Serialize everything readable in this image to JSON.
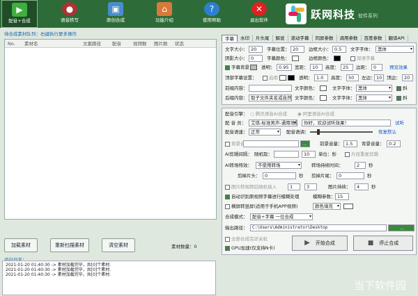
{
  "toolbar": {
    "items": [
      {
        "label": "配音+合成"
      },
      {
        "label": "语音转写"
      },
      {
        "label": "原创合成"
      },
      {
        "label": "功能介绍"
      },
      {
        "label": "使用帮助"
      },
      {
        "label": "退出软件"
      }
    ]
  },
  "brand": {
    "name": "跃网科技",
    "sub": "软件系列"
  },
  "queue": {
    "title": "待合成素材队列：右键执行更多操作",
    "headers": [
      "No.",
      "素材名",
      "文案路径",
      "配音",
      "视频数",
      "图片数",
      "状态"
    ],
    "load": "加载素材",
    "rescan": "重新扫描素材",
    "clear": "清空素材",
    "count_label": "素材数量：",
    "count": "0"
  },
  "log": {
    "title": "运行日志：",
    "lines": [
      "2021-01-20 01:40:30 -> 素材加载完毕，共[0]个素材.",
      "2021-01-20 01:40:30 -> 素材加载完毕，共[0]个素材.",
      "2021-01-20 01:40:30 -> 素材加载完毕，共[0]个素材."
    ]
  },
  "tabs": [
    "字幕",
    "水印",
    "片头尾",
    "解说",
    "滚动字幕",
    "同屏参数",
    "调用参数",
    "百度参数",
    "翻译API"
  ],
  "sub": {
    "font_size": "文字大小：",
    "font_size_v": "20",
    "pos": "字幕位置：",
    "pos_v": "20",
    "border": "边框大小：",
    "border_v": "0.5",
    "font": "文字字体：",
    "font_v": "黑体",
    "shadow": "阴影大小：",
    "shadow_v": "0",
    "color": "字幕颜色：",
    "bcolor": "边框颜色：",
    "dual": "双语字幕",
    "bg": "字幕背景",
    "alpha": "透明：",
    "alpha_v": "0.95",
    "wid": "宽距：",
    "wid_v": "10",
    "hgt": "高度：",
    "hgt_v": "25",
    "edge": "边距：",
    "edge_v": "0",
    "preview": "预览效果",
    "top": "顶部字幕设置：",
    "en": "启用",
    "alpha2": "透明：",
    "alpha2_v": "1.0",
    "height2": "高度：",
    "height2_v": "50",
    "left": "左边：",
    "left_v": "10",
    "topd": "顶边：",
    "topd_v": "20",
    "head": "前缀内容：",
    "tcolor": "文字颜色：",
    "tfont": "文字字体：",
    "tfont_v": "黑体",
    "italic": "斜",
    "tail": "后缀内容：",
    "tail_v": "取子文件夹名或自然",
    "tcolor2": "文字颜色：",
    "tfont2": "文字字体：",
    "tfont2_v": "黑体",
    "italic2": "斜"
  },
  "voice": {
    "engine": "配音引擎：",
    "opt1": "腾讯语音AI合成",
    "opt2": "阿里语音AI合成",
    "voice": "配 音 员：",
    "voice_v": "艾琪-标准男声-通用场景",
    "text_v": "你好，欢迎试听效果！",
    "listen": "试听",
    "speed": "配音语速：",
    "speed_v": "正常",
    "pitch": "配音语调：",
    "default": "恢复默认",
    "bgm": "背景音",
    "vol": "前景音量：",
    "vol_v": "1.5",
    "bvol": "背景音量：",
    "bvol_v": "0.2",
    "ai": "AI剪辑间隔：",
    "rand": "随机取：",
    "interval": "10",
    "sec": "单位：秒",
    "smart": "片段重复剪辑",
    "trans": "AI转场特效：",
    "trans_v": "不使用转场",
    "trans_t": "转场持续时间：",
    "trans_t_v": "2",
    "sec2": "秒",
    "cuthead": "剪掉片头：",
    "cuthead_v": "0",
    "sec3": "秒",
    "cuttail": "剪掉片尾：",
    "cuttail_v": "0",
    "sec4": "秒",
    "img": "图片转视频后随机插入",
    "img_a": "1",
    "img_b": "3",
    "img_dur": "图片持续：",
    "img_dur_v": "4",
    "sec5": "秒",
    "auto": "自动识别原视频字幕进行模糊处理",
    "blur": "模糊参数：",
    "blur_v": "15",
    "fill": "横屏转竖屏(适用于手机APP视频)",
    "fill_c": "颜色填充",
    "mode": "合成模式：",
    "mode_v": "配音+字幕 一位合成",
    "out": "输出路径：",
    "out_v": "C:\\Users\\Administrator\\Desktop",
    "browse": "...",
    "shutdown": "全部合成完毕关机",
    "gpu": "GPU加速(仅支持N卡)",
    "start": "开始合成",
    "stop": "停止合成"
  },
  "watermark": "当下软件园"
}
